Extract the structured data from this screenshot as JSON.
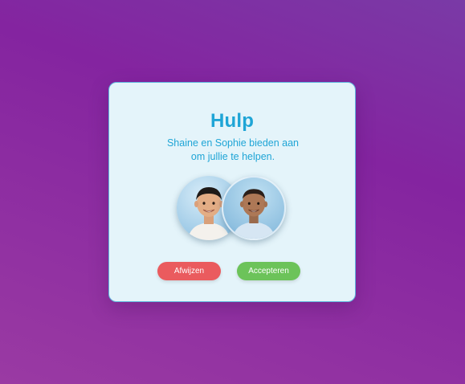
{
  "dialog": {
    "title": "Hulp",
    "message_line1": "Shaine en Sophie bieden aan",
    "message_line2": "om jullie te helpen.",
    "helpers": [
      "Shaine",
      "Sophie"
    ],
    "decline_label": "Afwijzen",
    "accept_label": "Accepteren"
  },
  "colors": {
    "background_start": "#7a3aa6",
    "background_end": "#9a3aa3",
    "dialog_bg": "#e4f4fa",
    "dialog_border": "#5fb6dd",
    "title_text": "#1fa5d6",
    "decline": "#ea5b5e",
    "accept": "#6cc35a"
  }
}
